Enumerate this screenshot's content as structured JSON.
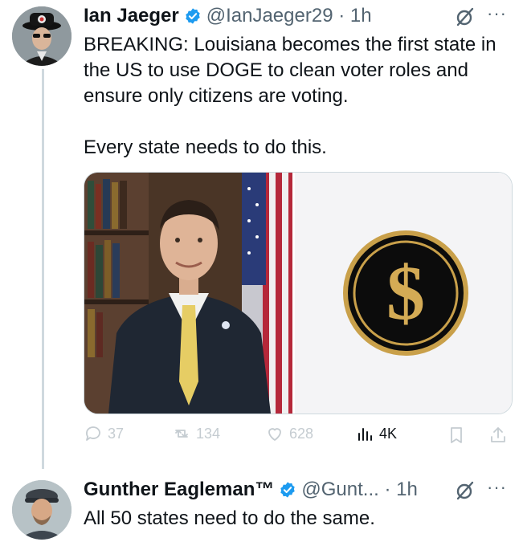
{
  "tweet1": {
    "name": "Ian Jaeger",
    "handle_time": "@IanJaeger29 · 1h",
    "text": "BREAKING: Louisiana becomes the first state in the US to use DOGE to clean voter roles and ensure only citizens are voting.\n\nEvery state needs to do this.",
    "media": [
      "portrait photo of man in suit in front of flag",
      "gold dollar sign coin logo"
    ],
    "replies": "37",
    "reposts": "134",
    "likes": "628",
    "views": "4K"
  },
  "tweet2": {
    "name": "Gunther Eagleman™",
    "handle_time": "@Gunt... · 1h",
    "text": "All 50 states need to do the same."
  },
  "icons": [
    "verified-badge-icon",
    "grok-icon",
    "more-icon",
    "reply-icon",
    "repost-icon",
    "like-icon",
    "views-icon",
    "bookmark-icon",
    "share-icon"
  ],
  "colors": {
    "verified": "#1d9bf0",
    "muted": "#536471",
    "coin_gold": "#c9a04a"
  }
}
